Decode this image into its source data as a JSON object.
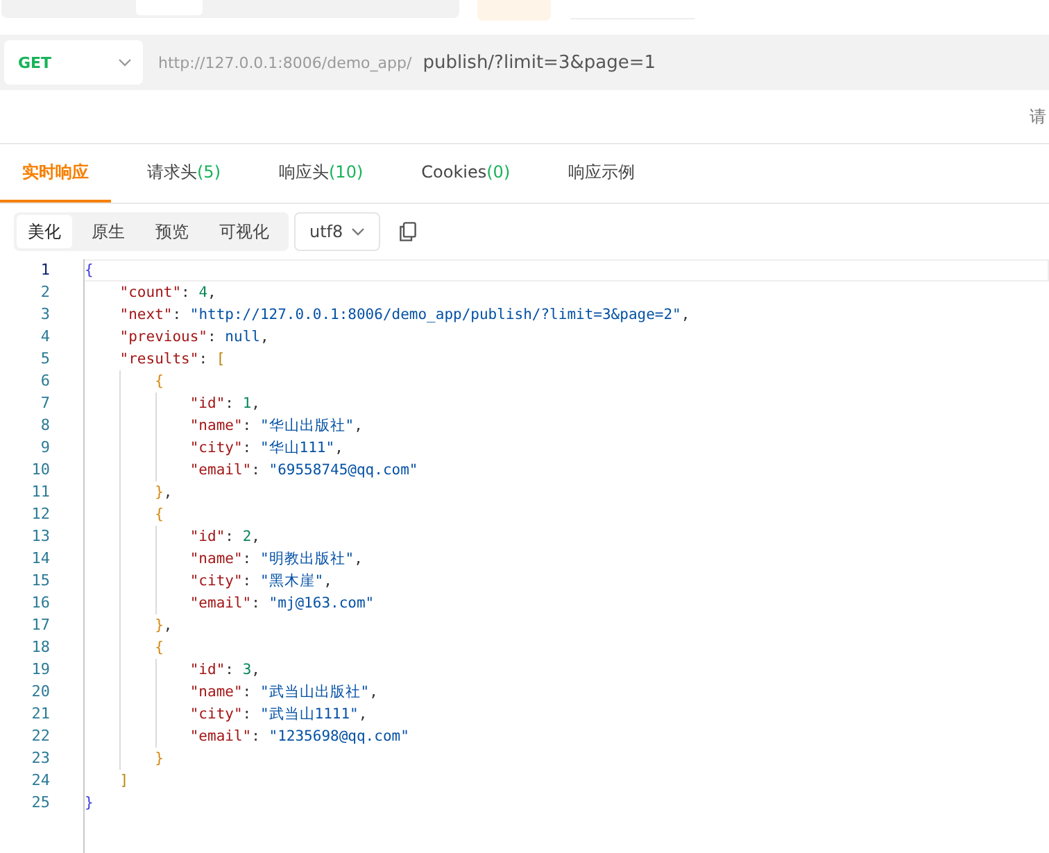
{
  "request": {
    "method": "GET",
    "base_url": "http://127.0.0.1:8006/demo_app/",
    "path": "publish/?limit=3&page=1"
  },
  "right_hint": "请",
  "response_tabs": [
    {
      "label": "实时响应",
      "selected": true
    },
    {
      "label": "请求头",
      "count": "(5)",
      "selected": false
    },
    {
      "label": "响应头",
      "count": "(10)",
      "selected": false
    },
    {
      "label": "Cookies",
      "count": "(0)",
      "selected": false
    },
    {
      "label": "响应示例",
      "selected": false
    }
  ],
  "view_modes": [
    {
      "label": "美化",
      "selected": true
    },
    {
      "label": "原生",
      "selected": false
    },
    {
      "label": "预览",
      "selected": false
    },
    {
      "label": "可视化",
      "selected": false
    }
  ],
  "encoding": "utf8",
  "code_lines": [
    {
      "number": "1",
      "current": true,
      "tokens": [
        {
          "kind": "bracket",
          "text": "{",
          "color": "#3b3bdb"
        }
      ]
    },
    {
      "number": "2",
      "current": false,
      "tokens": [
        {
          "kind": "key",
          "text": "    \"count\""
        },
        {
          "kind": "punct",
          "text": ": "
        },
        {
          "kind": "number",
          "text": "4"
        },
        {
          "kind": "punct",
          "text": ","
        }
      ]
    },
    {
      "number": "3",
      "current": false,
      "tokens": [
        {
          "kind": "key",
          "text": "    \"next\""
        },
        {
          "kind": "punct",
          "text": ": "
        },
        {
          "kind": "string",
          "text": "\"http://127.0.0.1:8006/demo_app/publish/?limit=3&page=2\""
        },
        {
          "kind": "punct",
          "text": ","
        }
      ]
    },
    {
      "number": "4",
      "current": false,
      "tokens": [
        {
          "kind": "key",
          "text": "    \"previous\""
        },
        {
          "kind": "punct",
          "text": ": "
        },
        {
          "kind": "null",
          "text": "null"
        },
        {
          "kind": "punct",
          "text": ","
        }
      ]
    },
    {
      "number": "5",
      "current": false,
      "tokens": [
        {
          "kind": "key",
          "text": "    \"results\""
        },
        {
          "kind": "punct",
          "text": ": "
        },
        {
          "kind": "bracket",
          "text": "[",
          "color": "#b8860b"
        }
      ]
    },
    {
      "number": "6",
      "current": false,
      "tokens": [
        {
          "kind": "bracket",
          "text": "        {",
          "color": "#d4880f"
        }
      ]
    },
    {
      "number": "7",
      "current": false,
      "tokens": [
        {
          "kind": "key",
          "text": "            \"id\""
        },
        {
          "kind": "punct",
          "text": ": "
        },
        {
          "kind": "number",
          "text": "1"
        },
        {
          "kind": "punct",
          "text": ","
        }
      ]
    },
    {
      "number": "8",
      "current": false,
      "tokens": [
        {
          "kind": "key",
          "text": "            \"name\""
        },
        {
          "kind": "punct",
          "text": ": "
        },
        {
          "kind": "string",
          "text": "\"华山出版社\""
        },
        {
          "kind": "punct",
          "text": ","
        }
      ]
    },
    {
      "number": "9",
      "current": false,
      "tokens": [
        {
          "kind": "key",
          "text": "            \"city\""
        },
        {
          "kind": "punct",
          "text": ": "
        },
        {
          "kind": "string",
          "text": "\"华山111\""
        },
        {
          "kind": "punct",
          "text": ","
        }
      ]
    },
    {
      "number": "10",
      "current": false,
      "tokens": [
        {
          "kind": "key",
          "text": "            \"email\""
        },
        {
          "kind": "punct",
          "text": ": "
        },
        {
          "kind": "string",
          "text": "\"69558745@qq.com\""
        }
      ]
    },
    {
      "number": "11",
      "current": false,
      "tokens": [
        {
          "kind": "bracket",
          "text": "        }",
          "color": "#d4880f"
        },
        {
          "kind": "punct",
          "text": ","
        }
      ]
    },
    {
      "number": "12",
      "current": false,
      "tokens": [
        {
          "kind": "bracket",
          "text": "        {",
          "color": "#d4880f"
        }
      ]
    },
    {
      "number": "13",
      "current": false,
      "tokens": [
        {
          "kind": "key",
          "text": "            \"id\""
        },
        {
          "kind": "punct",
          "text": ": "
        },
        {
          "kind": "number",
          "text": "2"
        },
        {
          "kind": "punct",
          "text": ","
        }
      ]
    },
    {
      "number": "14",
      "current": false,
      "tokens": [
        {
          "kind": "key",
          "text": "            \"name\""
        },
        {
          "kind": "punct",
          "text": ": "
        },
        {
          "kind": "string",
          "text": "\"明教出版社\""
        },
        {
          "kind": "punct",
          "text": ","
        }
      ]
    },
    {
      "number": "15",
      "current": false,
      "tokens": [
        {
          "kind": "key",
          "text": "            \"city\""
        },
        {
          "kind": "punct",
          "text": ": "
        },
        {
          "kind": "string",
          "text": "\"黑木崖\""
        },
        {
          "kind": "punct",
          "text": ","
        }
      ]
    },
    {
      "number": "16",
      "current": false,
      "tokens": [
        {
          "kind": "key",
          "text": "            \"email\""
        },
        {
          "kind": "punct",
          "text": ": "
        },
        {
          "kind": "string",
          "text": "\"mj@163.com\""
        }
      ]
    },
    {
      "number": "17",
      "current": false,
      "tokens": [
        {
          "kind": "bracket",
          "text": "        }",
          "color": "#d4880f"
        },
        {
          "kind": "punct",
          "text": ","
        }
      ]
    },
    {
      "number": "18",
      "current": false,
      "tokens": [
        {
          "kind": "bracket",
          "text": "        {",
          "color": "#d4880f"
        }
      ]
    },
    {
      "number": "19",
      "current": false,
      "tokens": [
        {
          "kind": "key",
          "text": "            \"id\""
        },
        {
          "kind": "punct",
          "text": ": "
        },
        {
          "kind": "number",
          "text": "3"
        },
        {
          "kind": "punct",
          "text": ","
        }
      ]
    },
    {
      "number": "20",
      "current": false,
      "tokens": [
        {
          "kind": "key",
          "text": "            \"name\""
        },
        {
          "kind": "punct",
          "text": ": "
        },
        {
          "kind": "string",
          "text": "\"武当山出版社\""
        },
        {
          "kind": "punct",
          "text": ","
        }
      ]
    },
    {
      "number": "21",
      "current": false,
      "tokens": [
        {
          "kind": "key",
          "text": "            \"city\""
        },
        {
          "kind": "punct",
          "text": ": "
        },
        {
          "kind": "string",
          "text": "\"武当山1111\""
        },
        {
          "kind": "punct",
          "text": ","
        }
      ]
    },
    {
      "number": "22",
      "current": false,
      "tokens": [
        {
          "kind": "key",
          "text": "            \"email\""
        },
        {
          "kind": "punct",
          "text": ": "
        },
        {
          "kind": "string",
          "text": "\"1235698@qq.com\""
        }
      ]
    },
    {
      "number": "23",
      "current": false,
      "tokens": [
        {
          "kind": "bracket",
          "text": "        }",
          "color": "#d4880f"
        }
      ]
    },
    {
      "number": "24",
      "current": false,
      "tokens": [
        {
          "kind": "bracket",
          "text": "    ]",
          "color": "#b8860b"
        }
      ]
    },
    {
      "number": "25",
      "current": false,
      "tokens": [
        {
          "kind": "bracket",
          "text": "}",
          "color": "#3b3bdb"
        }
      ]
    }
  ]
}
